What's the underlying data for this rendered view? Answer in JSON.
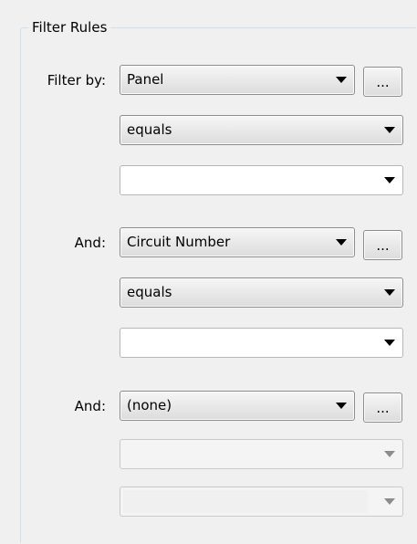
{
  "groupbox": {
    "title": "Filter Rules"
  },
  "rules": [
    {
      "label": "Filter by:",
      "field": "Panel",
      "operator": "equals",
      "value": "",
      "browse_label": "..."
    },
    {
      "label": "And:",
      "field": "Circuit Number",
      "operator": "equals",
      "value": "",
      "browse_label": "..."
    },
    {
      "label": "And:",
      "field": "(none)",
      "operator": "",
      "value": "",
      "browse_label": "..."
    }
  ],
  "icons": {
    "dropdown": "chevron-down-icon"
  }
}
